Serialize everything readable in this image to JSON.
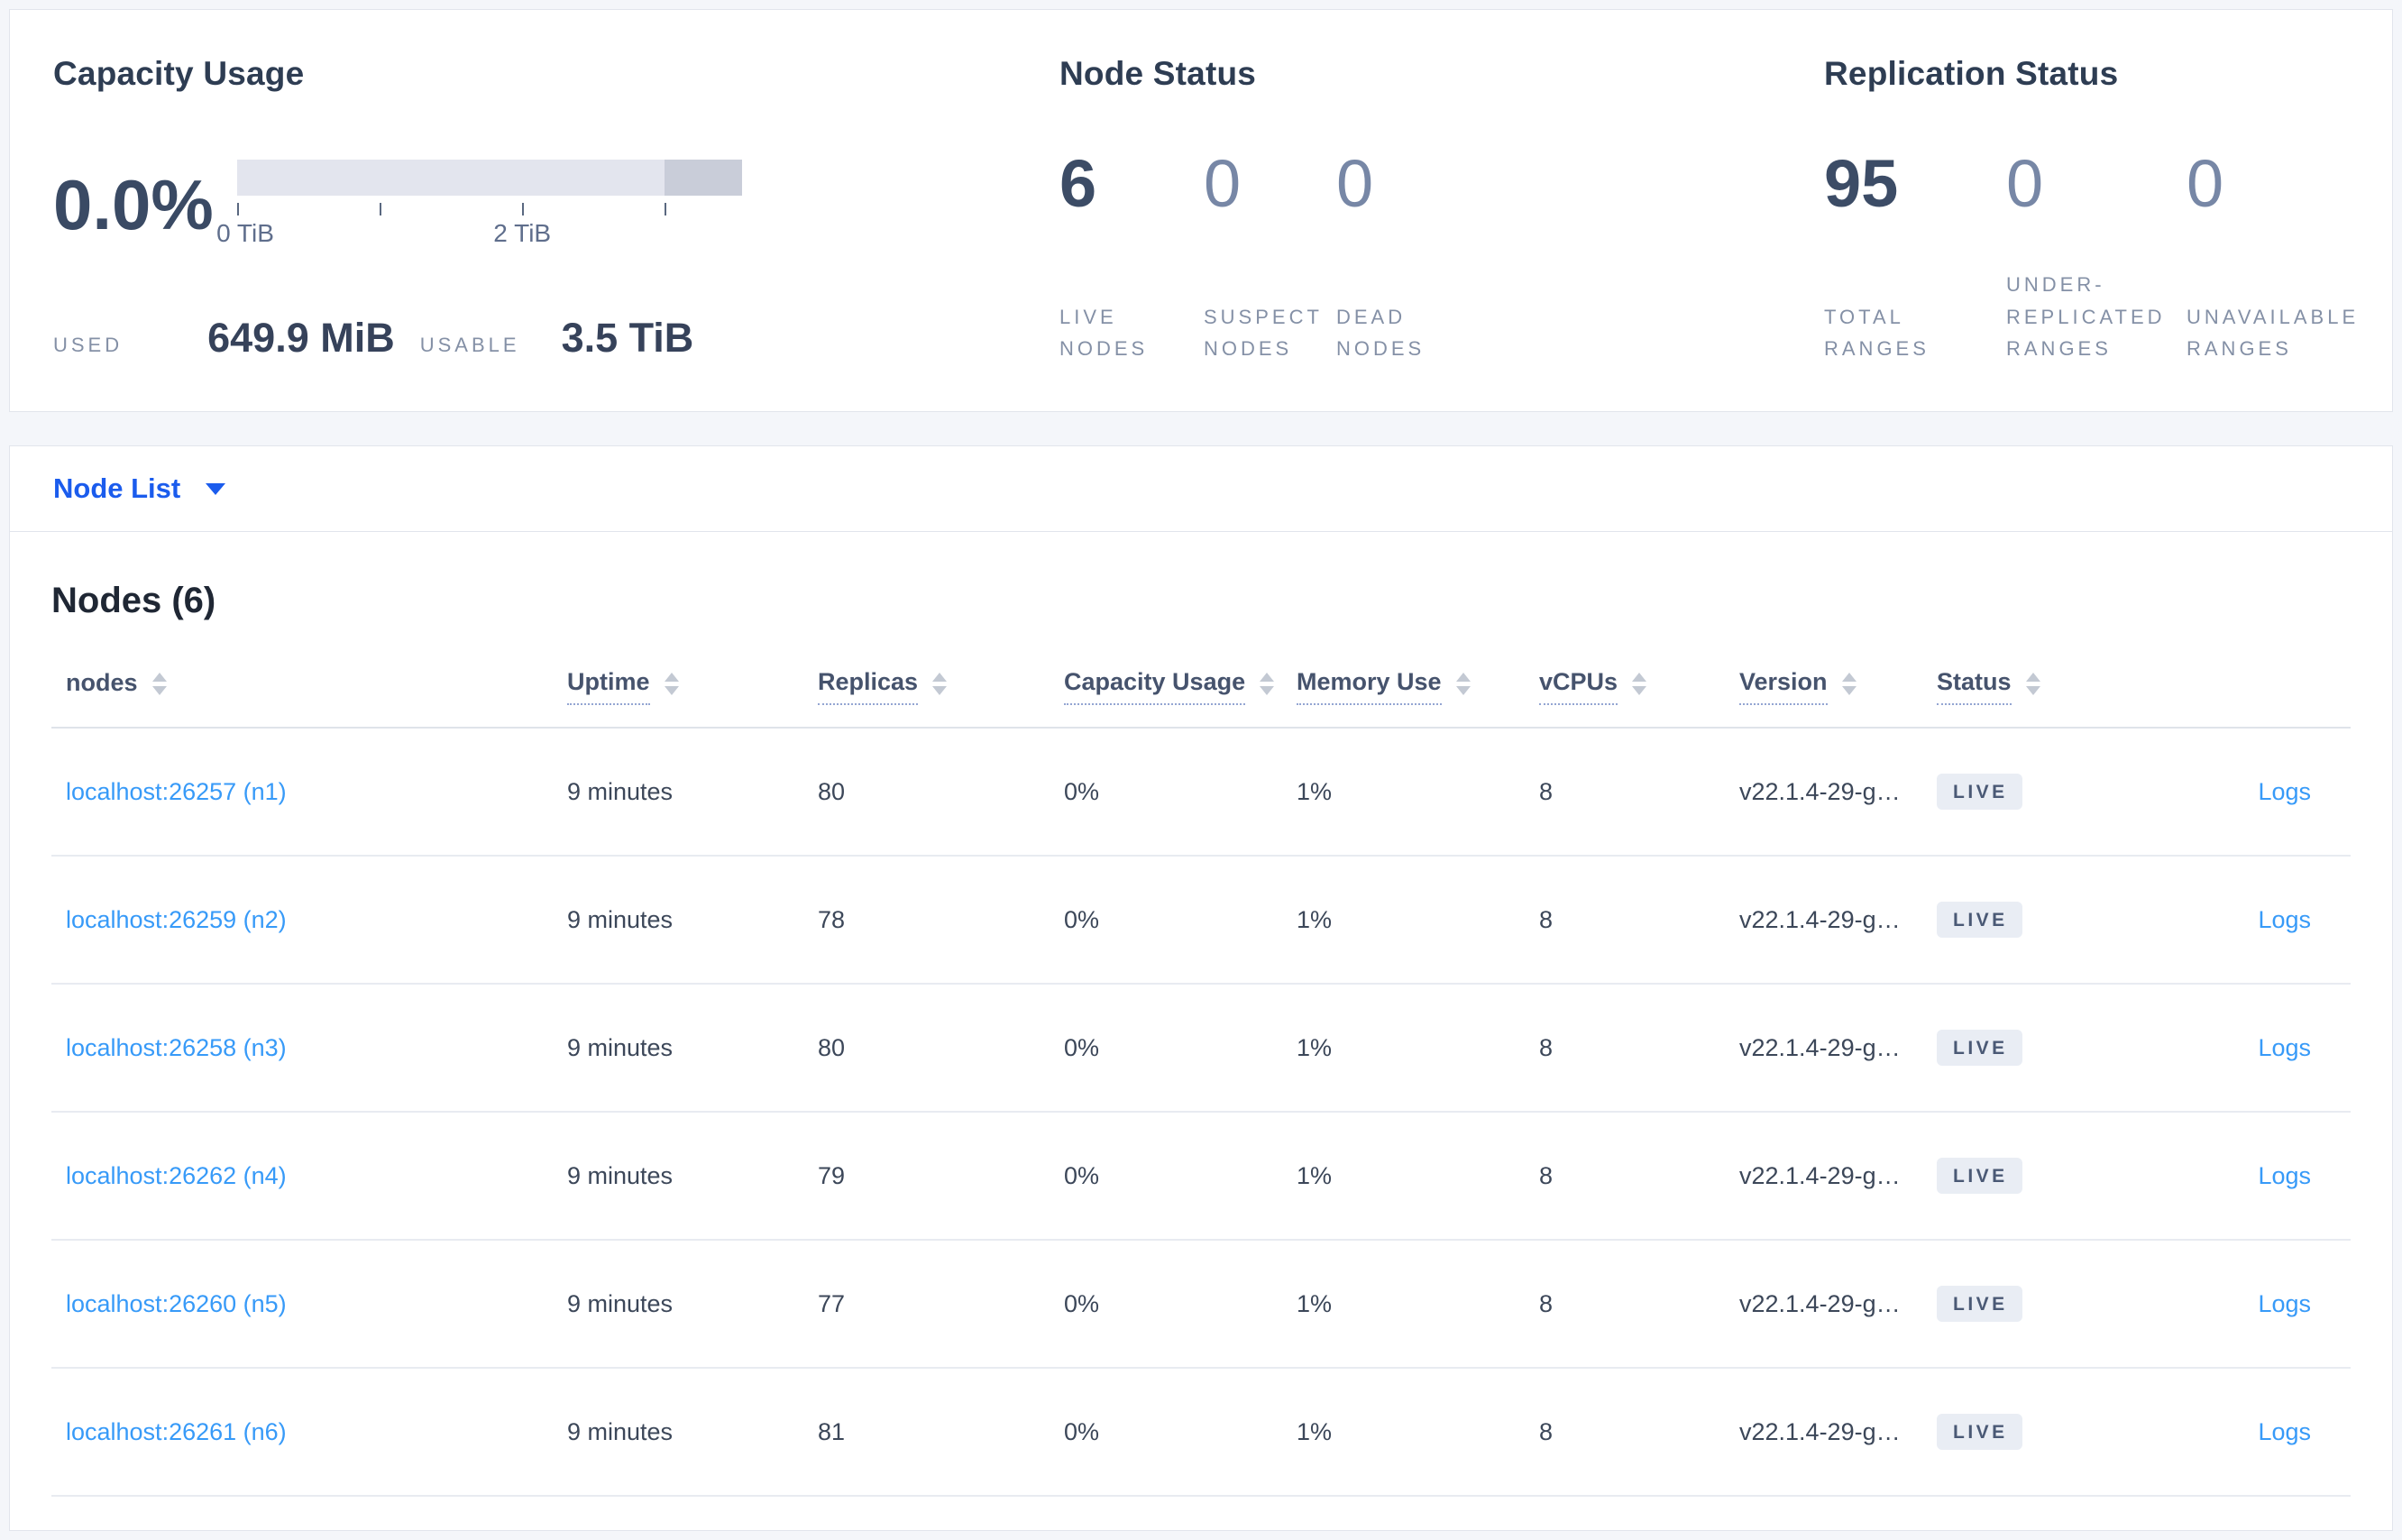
{
  "colors": {
    "page_bg": "#f4f6fa",
    "accent_blue": "#1b5ced",
    "link_blue": "#379af8",
    "badge_bg": "#e9edf4",
    "badge_text": "#4a5975",
    "gauge_light": "#e3e5ee",
    "gauge_dark": "#c9cdd9"
  },
  "capacity_panel": {
    "title": "Capacity Usage",
    "percent": "0.0%",
    "tick_label_0": "0 TiB",
    "tick_label_2": "2 TiB",
    "used_label": "USED",
    "used_value": "649.9 MiB",
    "usable_label": "USABLE",
    "usable_value": "3.5 TiB"
  },
  "node_status_panel": {
    "title": "Node Status",
    "stats": [
      {
        "value": "6",
        "label": "LIVE NODES"
      },
      {
        "value": "0",
        "label": "SUSPECT NODES"
      },
      {
        "value": "0",
        "label": "DEAD NODES"
      }
    ]
  },
  "replication_panel": {
    "title": "Replication Status",
    "stats": [
      {
        "value": "95",
        "label": "TOTAL RANGES"
      },
      {
        "value": "0",
        "label": "UNDER-REPLICATED RANGES"
      },
      {
        "value": "0",
        "label": "UNAVAILABLE RANGES"
      }
    ]
  },
  "view_selector": {
    "label": "Node List"
  },
  "nodes_table": {
    "title": "Nodes (6)",
    "headers": {
      "nodes": "nodes",
      "uptime": "Uptime",
      "replicas": "Replicas",
      "capacity": "Capacity Usage",
      "memory": "Memory Use",
      "vcpus": "vCPUs",
      "version": "Version",
      "status": "Status"
    },
    "rows": [
      {
        "address": "localhost:26257 (n1)",
        "uptime": "9 minutes",
        "replicas": "80",
        "capacity": "0%",
        "memory": "1%",
        "vcpus": "8",
        "version": "v22.1.4-29-g…",
        "status": "LIVE",
        "logs": "Logs"
      },
      {
        "address": "localhost:26259 (n2)",
        "uptime": "9 minutes",
        "replicas": "78",
        "capacity": "0%",
        "memory": "1%",
        "vcpus": "8",
        "version": "v22.1.4-29-g…",
        "status": "LIVE",
        "logs": "Logs"
      },
      {
        "address": "localhost:26258 (n3)",
        "uptime": "9 minutes",
        "replicas": "80",
        "capacity": "0%",
        "memory": "1%",
        "vcpus": "8",
        "version": "v22.1.4-29-g…",
        "status": "LIVE",
        "logs": "Logs"
      },
      {
        "address": "localhost:26262 (n4)",
        "uptime": "9 minutes",
        "replicas": "79",
        "capacity": "0%",
        "memory": "1%",
        "vcpus": "8",
        "version": "v22.1.4-29-g…",
        "status": "LIVE",
        "logs": "Logs"
      },
      {
        "address": "localhost:26260 (n5)",
        "uptime": "9 minutes",
        "replicas": "77",
        "capacity": "0%",
        "memory": "1%",
        "vcpus": "8",
        "version": "v22.1.4-29-g…",
        "status": "LIVE",
        "logs": "Logs"
      },
      {
        "address": "localhost:26261 (n6)",
        "uptime": "9 minutes",
        "replicas": "81",
        "capacity": "0%",
        "memory": "1%",
        "vcpus": "8",
        "version": "v22.1.4-29-g…",
        "status": "LIVE",
        "logs": "Logs"
      }
    ]
  }
}
